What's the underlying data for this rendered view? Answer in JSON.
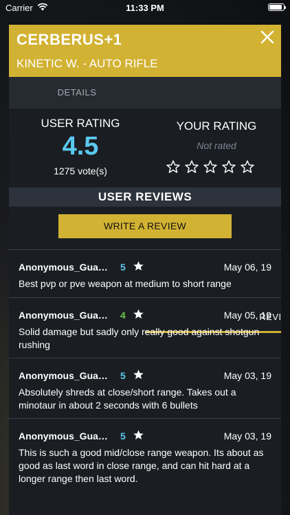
{
  "status_bar": {
    "carrier": "Carrier",
    "time": "11:33 PM"
  },
  "header": {
    "title": "CERBERUS+1",
    "subtitle": "KINETIC W. - AUTO RIFLE",
    "accent_color": "#d2b233",
    "close_icon": "close-icon"
  },
  "tabs": [
    {
      "label": "DETAILS",
      "active": false
    },
    {
      "label": "REVIEWS",
      "active": true
    }
  ],
  "user_rating": {
    "label": "USER RATING",
    "value": "4.5",
    "votes": "1275 vote(s)",
    "value_color": "#5bc8ee"
  },
  "your_rating": {
    "label": "YOUR RATING",
    "status": "Not rated",
    "stars_filled": 0,
    "stars_total": 5
  },
  "user_reviews": {
    "title": "USER REVIEWS",
    "write_button": "WRITE A REVIEW",
    "items": [
      {
        "user": "Anonymous_Gua…",
        "score": "5",
        "score_color": "#5bc8ee",
        "date": "May 06, 19",
        "text": "Best pvp or pve weapon at medium to short range"
      },
      {
        "user": "Anonymous_Gua…",
        "score": "4",
        "score_color": "#6cc84f",
        "date": "May 05, 19",
        "text": "Solid damage but sadly only really good against shotgun rushing"
      },
      {
        "user": "Anonymous_Gua…",
        "score": "5",
        "score_color": "#5bc8ee",
        "date": "May 03, 19",
        "text": "Absolutely shreds at close/short range. Takes out a minotaur in about 2 seconds with 6 bullets"
      },
      {
        "user": "Anonymous_Gua…",
        "score": "5",
        "score_color": "#5bc8ee",
        "date": "May 03, 19",
        "text": "This is such a good mid/close range weapon. Its about as good as last word in close range, and can hit hard at a longer range then last word."
      }
    ]
  }
}
